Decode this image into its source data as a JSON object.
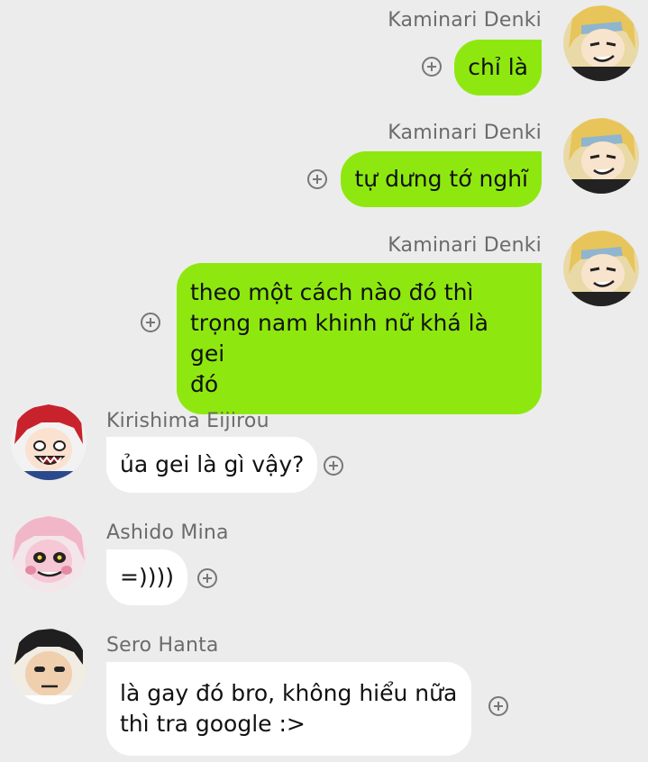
{
  "messages": [
    {
      "id": "m1",
      "sender": "Kaminari Denki",
      "direction": "outgoing",
      "text": "chỉ là",
      "avatar_icon": "kaminari-avatar-icon"
    },
    {
      "id": "m2",
      "sender": "Kaminari Denki",
      "direction": "outgoing",
      "text": "tự dưng tớ nghĩ",
      "avatar_icon": "kaminari-avatar-icon"
    },
    {
      "id": "m3",
      "sender": "Kaminari Denki",
      "direction": "outgoing",
      "text": "theo một cách nào đó thì\ntrọng nam khinh nữ khá là gei\nđó",
      "avatar_icon": "kaminari-avatar-icon"
    },
    {
      "id": "m4",
      "sender": "Kirishima Eijirou",
      "direction": "incoming",
      "text": "ủa gei là gì vậy?",
      "avatar_icon": "kirishima-avatar-icon"
    },
    {
      "id": "m5",
      "sender": "Ashido Mina",
      "direction": "incoming",
      "text": "=))))",
      "avatar_icon": "ashido-avatar-icon"
    },
    {
      "id": "m6",
      "sender": "Sero Hanta",
      "direction": "incoming",
      "text": "là gay đó bro, không hiểu nữa\nthì tra google :>",
      "avatar_icon": "sero-avatar-icon"
    }
  ],
  "colors": {
    "background": "#ececec",
    "outgoing_bubble": "#8ee80f",
    "incoming_bubble": "#ffffff",
    "name_text": "#6b6b6b"
  },
  "icons": {
    "reaction_button": "plus-circle-icon"
  }
}
